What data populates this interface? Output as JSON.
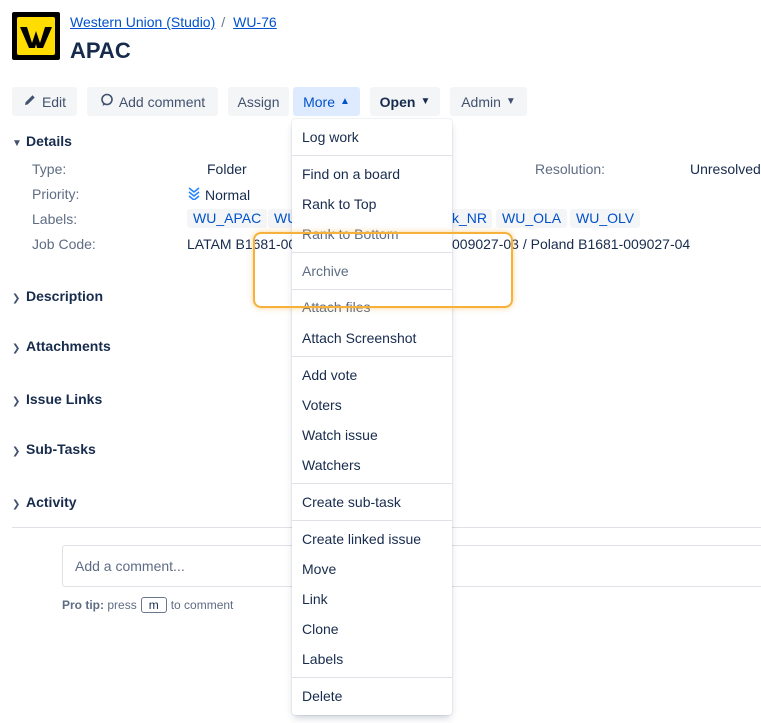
{
  "breadcrumb": {
    "project": "Western Union (Studio)",
    "separator": "/",
    "issue_key": "WU-76"
  },
  "issue": {
    "title": "APAC"
  },
  "toolbar": {
    "edit": "Edit",
    "add_comment": "Add comment",
    "assign": "Assign",
    "more": "More",
    "open": "Open",
    "admin": "Admin"
  },
  "details": {
    "heading": "Details",
    "type_label": "Type:",
    "type_value": "Folder",
    "priority_label": "Priority:",
    "priority_value": "Normal",
    "labels_label": "Labels:",
    "labels": [
      "WU_APAC",
      "WU",
      "k_NR",
      "WU_OLA",
      "WU_OLV"
    ],
    "job_code_label": "Job Code:",
    "job_code_left": "LATAM B1681-00",
    "job_code_right": "009027-03 / Poland B1681-009027-04",
    "resolution_label": "Resolution:",
    "resolution_value": "Unresolved"
  },
  "sections": {
    "description": "Description",
    "attachments": "Attachments",
    "issue_links": "Issue Links",
    "sub_tasks": "Sub-Tasks",
    "activity": "Activity"
  },
  "comment": {
    "placeholder": "Add a comment...",
    "protip_label": "Pro tip:",
    "protip_press": "press",
    "protip_key": "m",
    "protip_suffix": "to comment"
  },
  "menu": {
    "groups": [
      [
        "Log work"
      ],
      [
        "Find on a board",
        "Rank to Top",
        "Rank to Bottom"
      ],
      [
        "Archive"
      ],
      [
        "Attach files",
        "Attach Screenshot"
      ],
      [
        "Add vote",
        "Voters",
        "Watch issue",
        "Watchers"
      ],
      [
        "Create sub-task"
      ],
      [
        "Create linked issue",
        "Move",
        "Link",
        "Clone",
        "Labels"
      ],
      [
        "Delete"
      ]
    ]
  },
  "colors": {
    "accent": "#0052cc",
    "highlight": "#f6b13c",
    "logo_yellow": "#ffdd00"
  }
}
